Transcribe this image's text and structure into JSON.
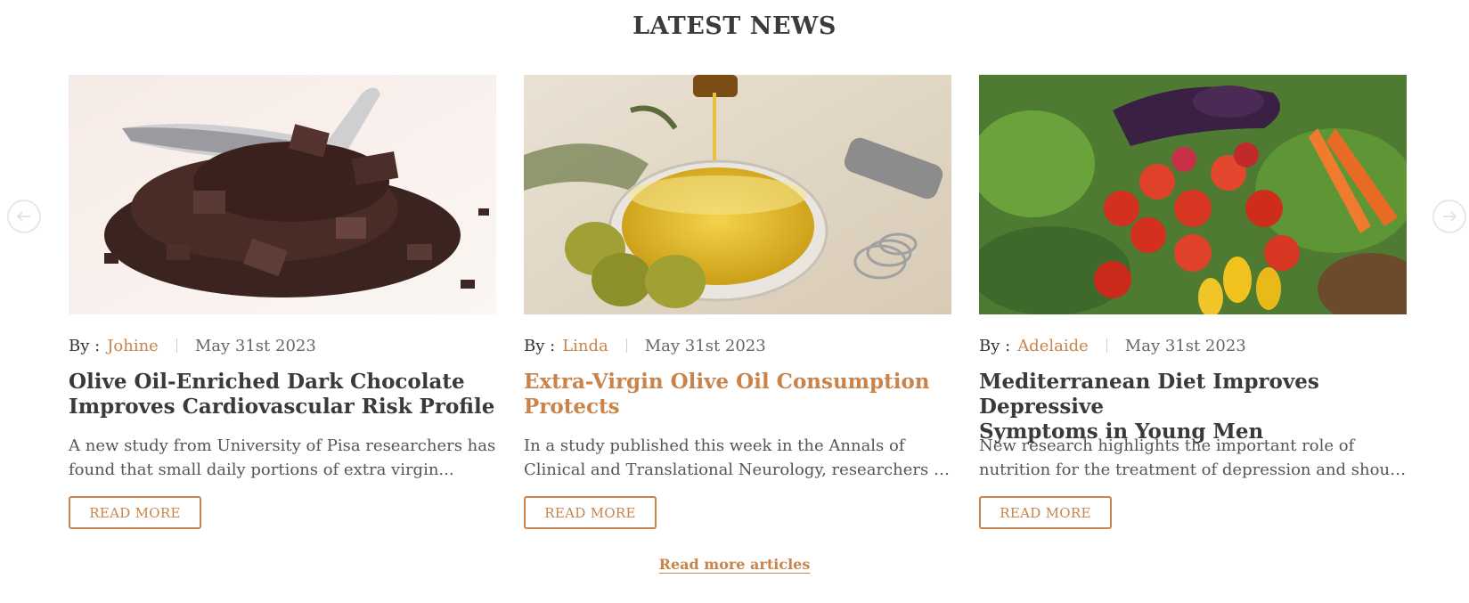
{
  "section": {
    "title": "LATEST NEWS",
    "more_link": "Read more articles"
  },
  "nav": {
    "prev_icon": "arrow-left-icon",
    "next_icon": "arrow-right-icon"
  },
  "colors": {
    "accent": "#c8844a",
    "title": "#3a3a3a"
  },
  "articles": [
    {
      "by_label": "By :",
      "author": "Johine",
      "date": "May 31st 2023",
      "title_line1": "Olive Oil-Enriched Dark Chocolate",
      "title_line2": "Improves Cardiovascular Risk Profile",
      "excerpt_line1": "A new study from University of Pisa researchers has",
      "excerpt_line2": "found that small daily portions of extra virgin...",
      "button": "READ MORE",
      "image": "dark chocolate pieces with spoon"
    },
    {
      "by_label": "By :",
      "author": "Linda",
      "date": "May 31st 2023",
      "title_line1": "Extra-Virgin Olive Oil Consumption",
      "title_line2": "Protects",
      "excerpt_line1": "In a study published this week in the Annals of",
      "excerpt_line2": "Clinical and Translational Neurology, researchers fr...",
      "button": "READ MORE",
      "image": "olive oil pouring into glass bowl with olives"
    },
    {
      "by_label": "By :",
      "author": "Adelaide",
      "date": "May 31st 2023",
      "title_line1": "Mediterranean Diet Improves Depressive",
      "title_line2": "Symptoms in Young Men",
      "excerpt_line1": "New research highlights the important role of",
      "excerpt_line2": "nutrition for the treatment of depression and shoul...",
      "button": "READ MORE",
      "image": "tomatoes, peppers, eggplant and salad greens"
    }
  ]
}
